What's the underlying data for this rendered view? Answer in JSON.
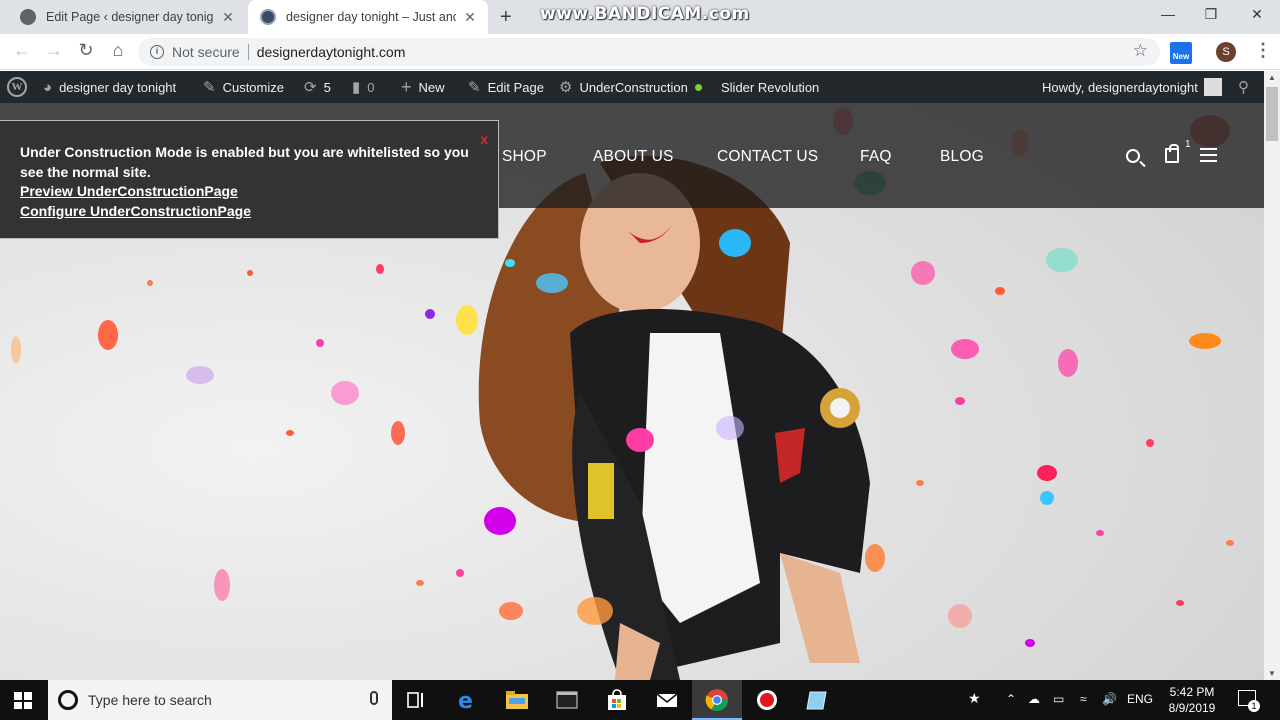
{
  "watermark": "www.BANDICAM.com",
  "tabs": [
    {
      "title": "Edit Page ‹ designer day tonight",
      "close": "✕"
    },
    {
      "title": "designer day tonight – Just anoth",
      "close": "✕"
    }
  ],
  "new_tab": "+",
  "window_controls": {
    "minimize": "—",
    "restore": "❐",
    "close": "✕"
  },
  "toolbar": {
    "back": "←",
    "forward": "→",
    "reload": "↻",
    "home": "⌂",
    "security_label": "Not secure",
    "url": "designerdaytonight.com",
    "star": "☆",
    "extension_badge": "New",
    "profile_initial": "S",
    "menu": "⋮"
  },
  "adminbar": {
    "site_name": "designer day tonight",
    "customize": "Customize",
    "updates_count": "5",
    "comments_count": "0",
    "new": "New",
    "edit_page": "Edit Page",
    "underconstruction": "UnderConstruction",
    "slider_revolution": "Slider Revolution",
    "howdy": "Howdy, designerdaytonight"
  },
  "site_nav": {
    "items": [
      "SHOP",
      "ABOUT US",
      "CONTACT US",
      "FAQ",
      "BLOG"
    ],
    "cart_count": "1"
  },
  "uc_notice": {
    "close": "x",
    "message": "Under Construction Mode is enabled but you are whitelisted so you see the normal site.",
    "preview_link": "Preview UnderConstructionPage",
    "configure_link": "Configure UnderConstructionPage"
  },
  "taskbar": {
    "search_placeholder": "Type here to search",
    "language": "ENG",
    "time": "5:42 PM",
    "date": "8/9/2019",
    "notification_count": "1"
  },
  "colors": {
    "admin_bar": "#23282d",
    "notice_close": "#e02b27",
    "status_dot": "#7ad03a",
    "taskbar": "#101010"
  }
}
